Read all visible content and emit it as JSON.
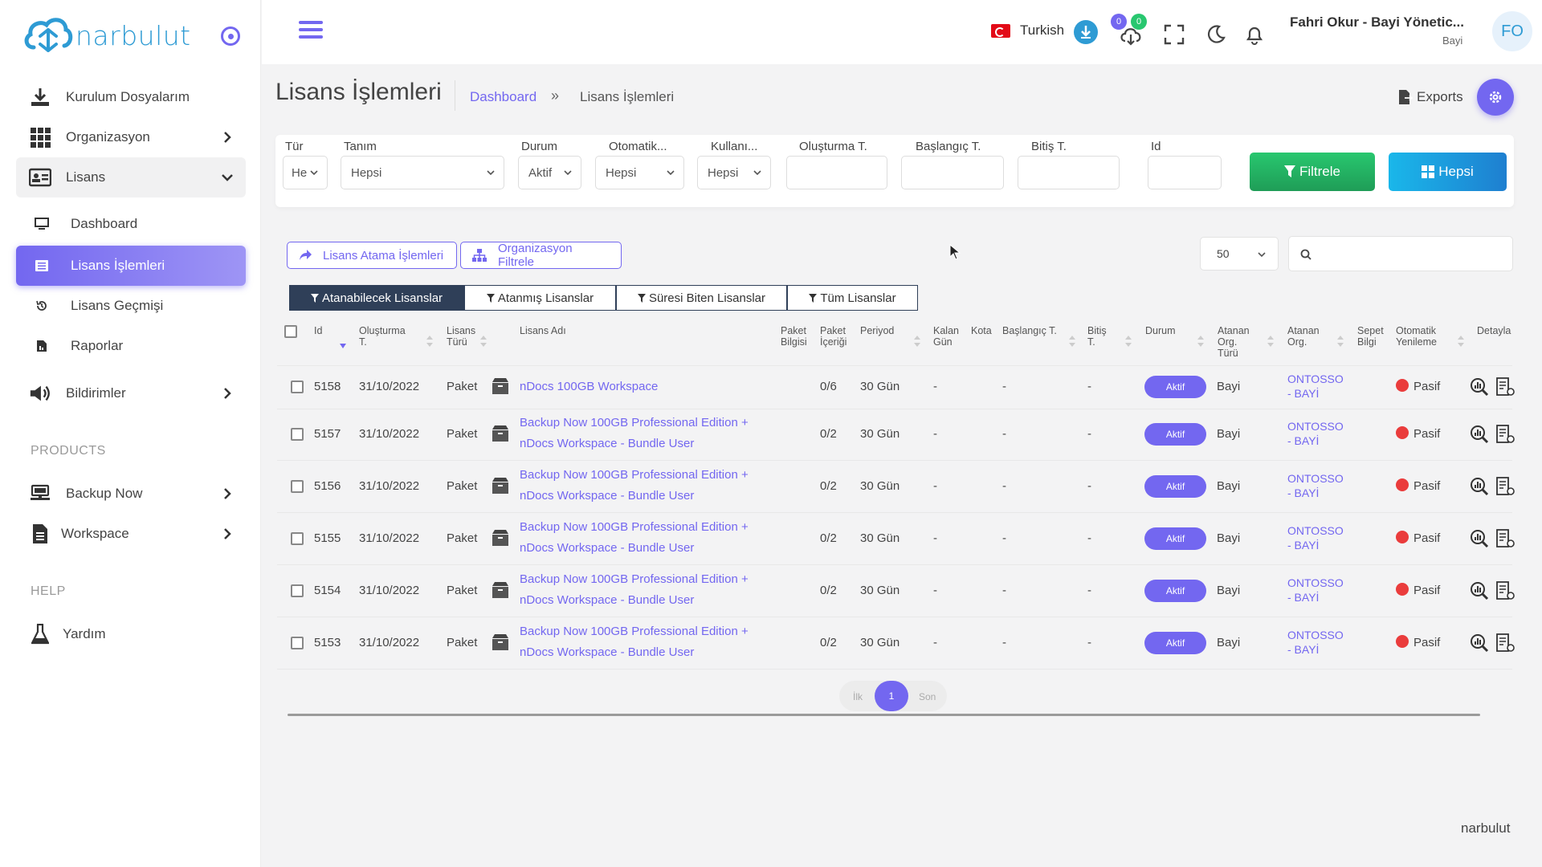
{
  "brand": {
    "name": "narbulut",
    "color": "#2e9bd4"
  },
  "colors": {
    "accent": "#7367f0",
    "success": "#28c76f",
    "info": "#1ab7ea",
    "danger": "#ea3c3c",
    "dark_tab": "#2f3f58"
  },
  "sidebar": {
    "items": [
      {
        "label": "Kurulum Dosyalarım",
        "icon": "download-icon"
      },
      {
        "label": "Organizasyon",
        "icon": "grid-icon"
      },
      {
        "label": "Lisans",
        "icon": "id-card-icon"
      },
      {
        "label": "Bildirimler",
        "icon": "megaphone-icon"
      }
    ],
    "lisans_sub": [
      {
        "label": "Dashboard",
        "icon": "monitor-icon"
      },
      {
        "label": "Lisans İşlemleri",
        "icon": "list-icon"
      },
      {
        "label": "Lisans Geçmişi",
        "icon": "history-icon"
      },
      {
        "label": "Raporlar",
        "icon": "report-icon"
      }
    ],
    "products_label": "PRODUCTS",
    "products": [
      {
        "label": "Backup Now",
        "icon": "server-icon"
      },
      {
        "label": "Workspace",
        "icon": "document-icon"
      }
    ],
    "help_label": "HELP",
    "help": [
      {
        "label": "Yardım",
        "icon": "flask-icon"
      }
    ]
  },
  "header": {
    "language": "Turkish",
    "badge_a": "0",
    "badge_b": "0",
    "user_name": "Fahri Okur - Bayi Yönetic...",
    "user_role": "Bayi",
    "avatar_initials": "FO"
  },
  "page": {
    "title": "Lisans İşlemleri",
    "breadcrumb_home": "Dashboard",
    "breadcrumb_sep": "»",
    "breadcrumb_current": "Lisans İşlemleri",
    "exports_label": "Exports"
  },
  "filters": {
    "labels": [
      "Tür",
      "Tanım",
      "Durum",
      "Otomatik...",
      "Kullanı...",
      "Oluşturma T.",
      "Başlangıç T.",
      "Bitiş T.",
      "Id"
    ],
    "values": {
      "tur": "He",
      "tanim": "Hepsi",
      "durum": "Aktif",
      "otomatik": "Hepsi",
      "kullanici": "Hepsi"
    },
    "filter_button": "Filtrele",
    "all_button": "Hepsi"
  },
  "actions": {
    "assign_button": "Lisans Atama İşlemleri",
    "org_filter_button": "Organizasyon Filtrele",
    "per_page": "50"
  },
  "tabs": [
    "Atanabilecek Lisanslar",
    "Atanmış Lisanslar",
    "Süresi Biten Lisanslar",
    "Tüm Lisanslar"
  ],
  "table": {
    "headers": {
      "id": "Id",
      "created": "Oluşturma T.",
      "type": "Lisans Türü",
      "name": "Lisans Adı",
      "pkg_info": "Paket Bilgisi",
      "pkg_content": "Paket İçeriği",
      "period": "Periyod",
      "remaining": "Kalan Gün",
      "quota": "Kota",
      "start": "Başlangıç T.",
      "end": "Bitiş T.",
      "status": "Durum",
      "assigned_org_type": "Atanan Org. Türü",
      "assigned_org": "Atanan Org.",
      "cart": "Sepet Bilgi",
      "auto_renew": "Otomatik Yenileme",
      "details": "Detayla"
    },
    "rows": [
      {
        "id": "5158",
        "created": "31/10/2022",
        "type": "Paket",
        "name1": "nDocs 100GB Workspace",
        "name2": "",
        "content": "0/6",
        "period": "30 Gün",
        "remaining": "-",
        "start": "-",
        "end": "-",
        "status": "Aktif",
        "org_type": "Bayi",
        "org1": "ONTOSSO",
        "org2": "- BAYİ",
        "renew": "Pasif"
      },
      {
        "id": "5157",
        "created": "31/10/2022",
        "type": "Paket",
        "name1": "Backup Now 100GB Professional Edition +",
        "name2": "nDocs Workspace - Bundle User",
        "content": "0/2",
        "period": "30 Gün",
        "remaining": "-",
        "start": "-",
        "end": "-",
        "status": "Aktif",
        "org_type": "Bayi",
        "org1": "ONTOSSO",
        "org2": "- BAYİ",
        "renew": "Pasif"
      },
      {
        "id": "5156",
        "created": "31/10/2022",
        "type": "Paket",
        "name1": "Backup Now 100GB Professional Edition +",
        "name2": "nDocs Workspace - Bundle User",
        "content": "0/2",
        "period": "30 Gün",
        "remaining": "-",
        "start": "-",
        "end": "-",
        "status": "Aktif",
        "org_type": "Bayi",
        "org1": "ONTOSSO",
        "org2": "- BAYİ",
        "renew": "Pasif"
      },
      {
        "id": "5155",
        "created": "31/10/2022",
        "type": "Paket",
        "name1": "Backup Now 100GB Professional Edition +",
        "name2": "nDocs Workspace - Bundle User",
        "content": "0/2",
        "period": "30 Gün",
        "remaining": "-",
        "start": "-",
        "end": "-",
        "status": "Aktif",
        "org_type": "Bayi",
        "org1": "ONTOSSO",
        "org2": "- BAYİ",
        "renew": "Pasif"
      },
      {
        "id": "5154",
        "created": "31/10/2022",
        "type": "Paket",
        "name1": "Backup Now 100GB Professional Edition +",
        "name2": "nDocs Workspace - Bundle User",
        "content": "0/2",
        "period": "30 Gün",
        "remaining": "-",
        "start": "-",
        "end": "-",
        "status": "Aktif",
        "org_type": "Bayi",
        "org1": "ONTOSSO",
        "org2": "- BAYİ",
        "renew": "Pasif"
      },
      {
        "id": "5153",
        "created": "31/10/2022",
        "type": "Paket",
        "name1": "Backup Now 100GB Professional Edition +",
        "name2": "nDocs Workspace - Bundle User",
        "content": "0/2",
        "period": "30 Gün",
        "remaining": "-",
        "start": "-",
        "end": "-",
        "status": "Aktif",
        "org_type": "Bayi",
        "org1": "ONTOSSO",
        "org2": "- BAYİ",
        "renew": "Pasif"
      }
    ]
  },
  "pagination": {
    "first": "İlk",
    "current": "1",
    "last": "Son"
  },
  "footer": {
    "text": "narbulut"
  }
}
